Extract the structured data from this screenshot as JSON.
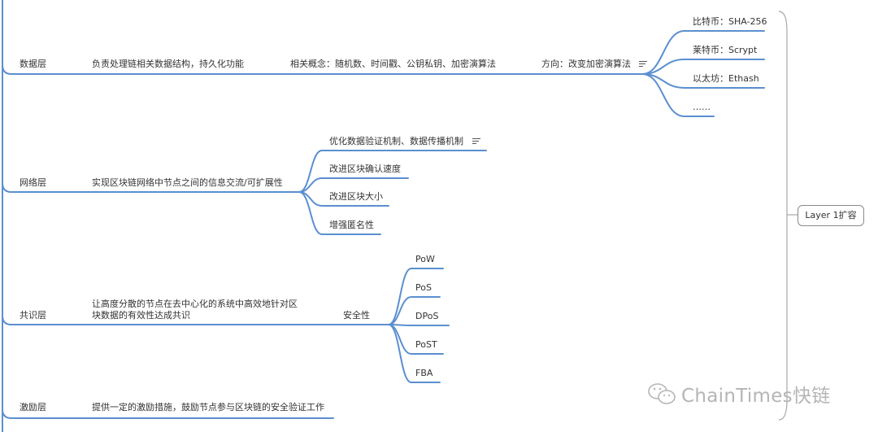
{
  "root": "Layer 1扩容",
  "layers": [
    {
      "name": "数据层",
      "desc": "负责处理链相关数据结构，持久化功能",
      "concept": "相关概念：随机数、时间戳、公钥私钥、加密演算法",
      "direction": "方向：改变加密演算法",
      "examples": [
        "比特币：SHA-256",
        "莱特币：Scrypt",
        "以太坊：Ethash",
        "……"
      ]
    },
    {
      "name": "网络层",
      "desc": "实现区块链网络中节点之间的信息交流/可扩展性",
      "items": [
        "优化数据验证机制、数据传播机制",
        "改进区块确认速度",
        "改进区块大小",
        "增强匿名性"
      ]
    },
    {
      "name": "共识层",
      "desc": "让高度分散的节点在去中心化的系统中高效地针对区块数据的有效性达成共识",
      "security": "安全性",
      "algorithms": [
        "PoW",
        "PoS",
        "DPoS",
        "PoST",
        "FBA"
      ]
    },
    {
      "name": "激励层",
      "desc": "提供一定的激励措施，鼓励节点参与区块链的安全验证工作"
    }
  ],
  "watermark": "ChainTimes快链",
  "colors": {
    "line": "#5b8fd0",
    "bracket": "#a8a8a8",
    "text": "#333333",
    "watermark": "#b5b5b5"
  }
}
